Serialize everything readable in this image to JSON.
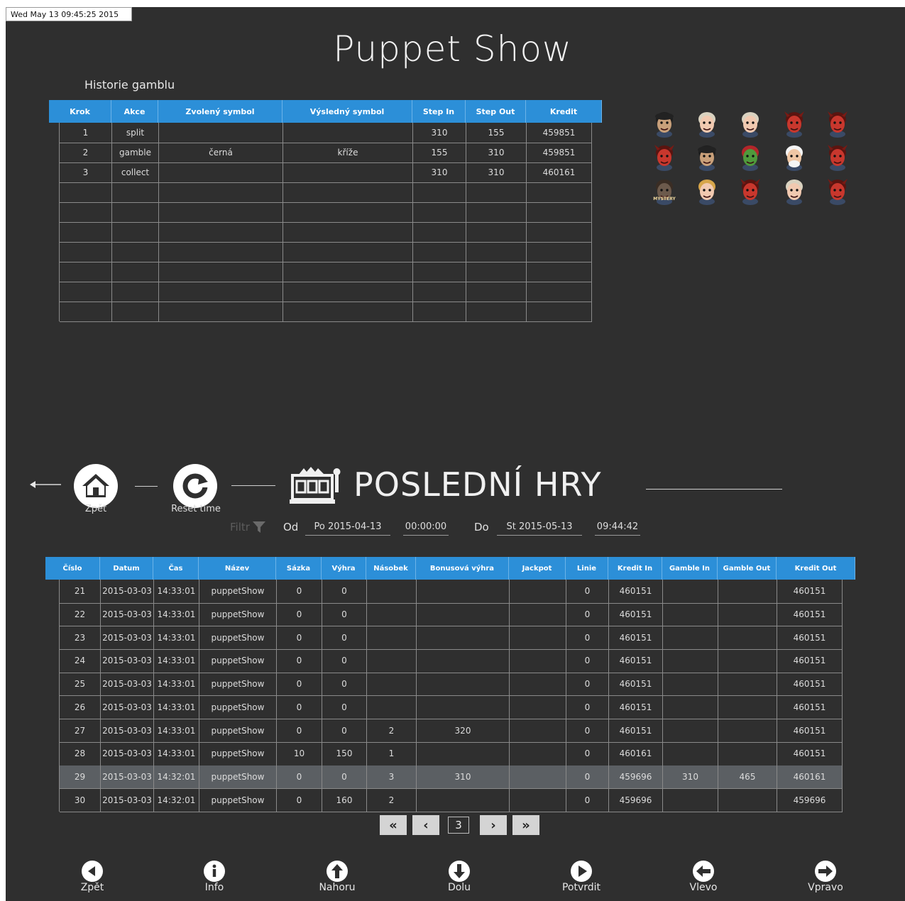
{
  "timestamp": "Wed May 13 09:45:25 2015",
  "app_title": "Puppet Show",
  "gamble_history": {
    "title": "Historie gamblu",
    "columns": [
      "Krok",
      "Akce",
      "Zvolený symbol",
      "Výsledný symbol",
      "Step In",
      "Step Out",
      "Kredit"
    ],
    "rows": [
      [
        "1",
        "split",
        "",
        "",
        "310",
        "155",
        "459851"
      ],
      [
        "2",
        "gamble",
        "černá",
        "kříže",
        "155",
        "310",
        "459851"
      ],
      [
        "3",
        "collect",
        "",
        "",
        "310",
        "310",
        "460161"
      ]
    ],
    "empty_rows": 7
  },
  "symbols": {
    "rows": [
      [
        "pirate",
        "lady",
        "lady",
        "devil",
        "devil"
      ],
      [
        "devil",
        "pirate",
        "goblin",
        "oldman",
        "devil"
      ],
      [
        "mystery",
        "blonde",
        "devil",
        "lady",
        "devil"
      ]
    ],
    "mystery_text": "MYSTERY"
  },
  "nav": {
    "back_label": "Zpět",
    "reset_label": "Reset time",
    "section_title": "POSLEDNÍ HRY"
  },
  "filter": {
    "label": "Filtr",
    "from_label": "Od",
    "from_date": "Po 2015-04-13",
    "from_time": "00:00:00",
    "to_label": "Do",
    "to_date": "St 2015-05-13",
    "to_time": "09:44:42"
  },
  "games": {
    "columns": [
      "Číslo",
      "Datum",
      "Čas",
      "Název",
      "Sázka",
      "Výhra",
      "Násobek",
      "Bonusová výhra",
      "Jackpot",
      "Linie",
      "Kredit In",
      "Gamble In",
      "Gamble Out",
      "Kredit Out"
    ],
    "rows": [
      [
        "21",
        "2015-03-03",
        "14:33:01",
        "puppetShow",
        "0",
        "0",
        "",
        "",
        "",
        "0",
        "460151",
        "",
        "",
        "460151"
      ],
      [
        "22",
        "2015-03-03",
        "14:33:01",
        "puppetShow",
        "0",
        "0",
        "",
        "",
        "",
        "0",
        "460151",
        "",
        "",
        "460151"
      ],
      [
        "23",
        "2015-03-03",
        "14:33:01",
        "puppetShow",
        "0",
        "0",
        "",
        "",
        "",
        "0",
        "460151",
        "",
        "",
        "460151"
      ],
      [
        "24",
        "2015-03-03",
        "14:33:01",
        "puppetShow",
        "0",
        "0",
        "",
        "",
        "",
        "0",
        "460151",
        "",
        "",
        "460151"
      ],
      [
        "25",
        "2015-03-03",
        "14:33:01",
        "puppetShow",
        "0",
        "0",
        "",
        "",
        "",
        "0",
        "460151",
        "",
        "",
        "460151"
      ],
      [
        "26",
        "2015-03-03",
        "14:33:01",
        "puppetShow",
        "0",
        "0",
        "",
        "",
        "",
        "0",
        "460151",
        "",
        "",
        "460151"
      ],
      [
        "27",
        "2015-03-03",
        "14:33:01",
        "puppetShow",
        "0",
        "0",
        "2",
        "320",
        "",
        "0",
        "460151",
        "",
        "",
        "460151"
      ],
      [
        "28",
        "2015-03-03",
        "14:33:01",
        "puppetShow",
        "10",
        "150",
        "1",
        "",
        "",
        "0",
        "460161",
        "",
        "",
        "460151"
      ],
      [
        "29",
        "2015-03-03",
        "14:32:01",
        "puppetShow",
        "0",
        "0",
        "3",
        "310",
        "",
        "0",
        "459696",
        "310",
        "465",
        "460161"
      ],
      [
        "30",
        "2015-03-03",
        "14:32:01",
        "puppetShow",
        "0",
        "160",
        "2",
        "",
        "",
        "0",
        "459696",
        "",
        "",
        "459696"
      ]
    ],
    "highlighted_number": "29"
  },
  "pager": {
    "first": "«",
    "prev": "‹",
    "page": "3",
    "next": "›",
    "last": "»"
  },
  "bottom_bar": [
    {
      "label": "Zpět",
      "icon": "back-circle-icon"
    },
    {
      "label": "Info",
      "icon": "info-icon"
    },
    {
      "label": "Nahoru",
      "icon": "arrow-up-icon"
    },
    {
      "label": "Dolu",
      "icon": "arrow-down-icon"
    },
    {
      "label": "Potvrdit",
      "icon": "play-icon"
    },
    {
      "label": "Vlevo",
      "icon": "arrow-left-icon"
    },
    {
      "label": "Vpravo",
      "icon": "arrow-right-icon"
    }
  ],
  "colors": {
    "background": "#2f2f2f",
    "header_blue": "#2c8fd8",
    "highlight_row": "#5b5f63"
  }
}
